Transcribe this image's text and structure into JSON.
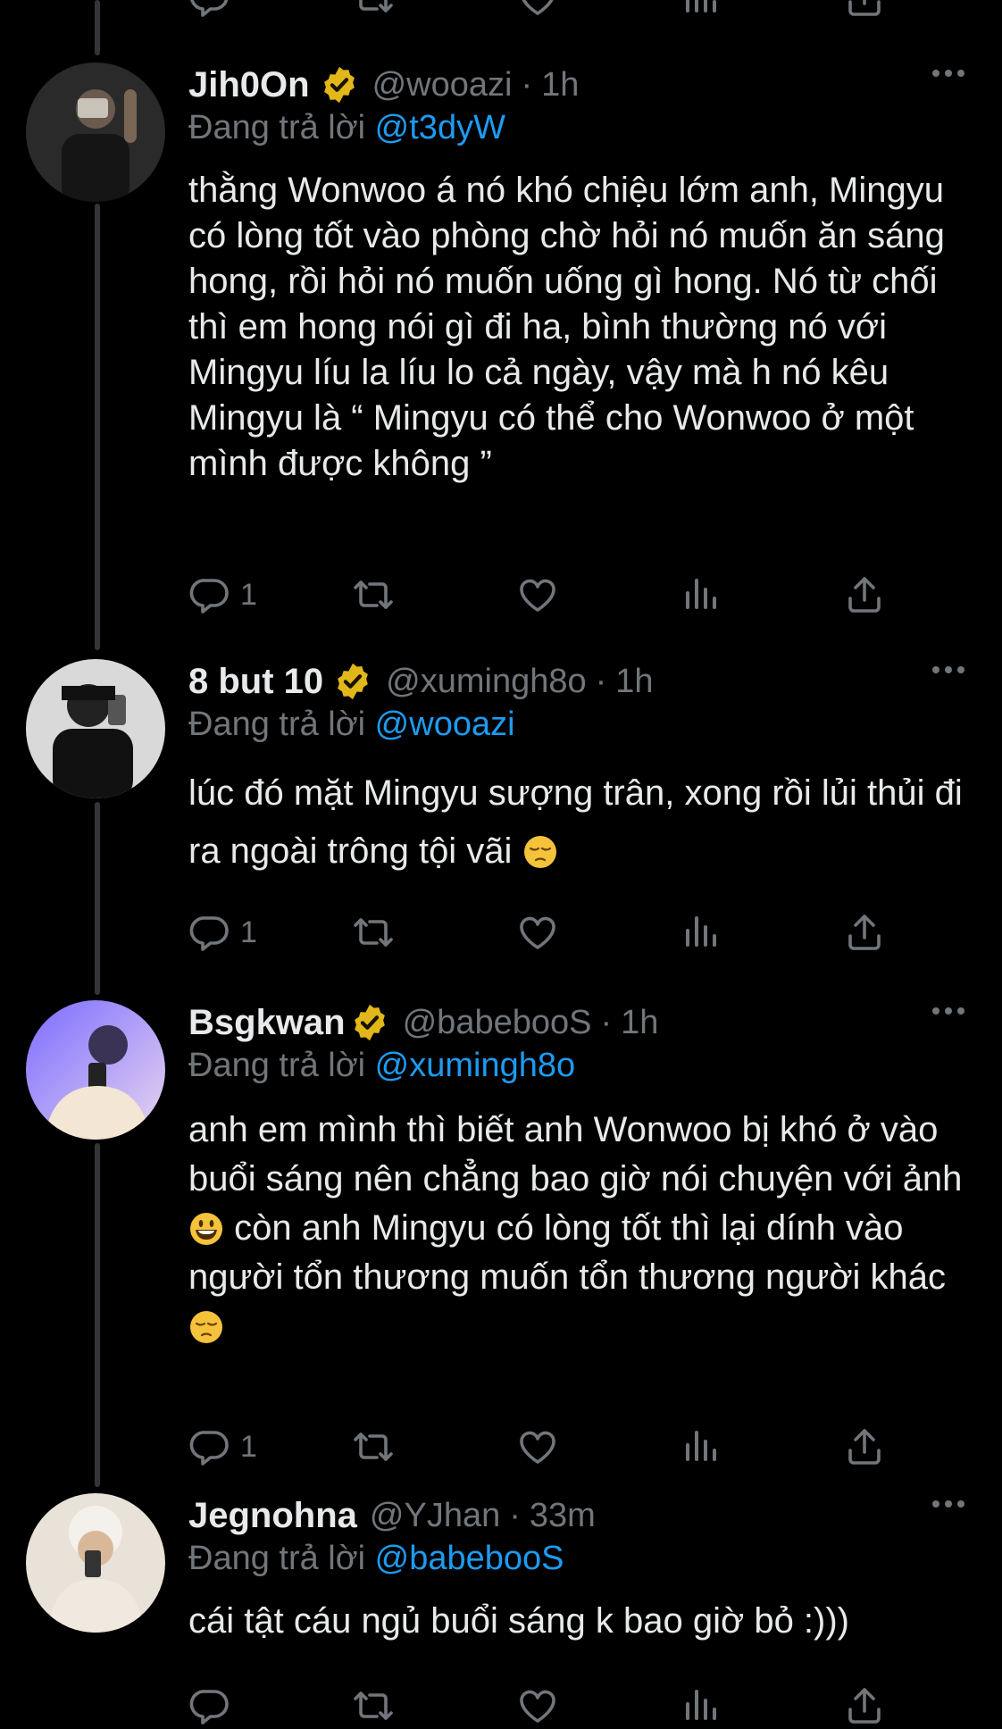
{
  "tweets": [
    {
      "name": "Jih0On",
      "handle": "@wooazi",
      "time": "1h",
      "replying_label": "Đang trả lời",
      "replying_to": "@t3dyW",
      "text": "thằng Wonwoo á nó khó chiệu lớm anh, Mingyu có lòng tốt vào phòng chờ hỏi nó muốn ăn sáng hong, rồi hỏi nó muốn uống gì hong. Nó từ chối thì em hong nói gì đi ha, bình thường nó với Mingyu líu la líu lo cả ngày, vậy mà h nó kêu Mingyu là “ Mingyu có thể cho Wonwoo ở một mình được không ”",
      "reply_count": "1"
    },
    {
      "name": "8 but 10",
      "handle": "@xumingh8o",
      "time": "1h",
      "replying_label": "Đang trả lời",
      "replying_to": "@wooazi",
      "text": "lúc đó mặt Mingyu sượng trân, xong rồi lủi thủi đi ra ngoài trông tội vãi",
      "emoji_end": "pensive-face",
      "reply_count": "1"
    },
    {
      "name": "Bsgkwan",
      "handle": "@babebooS",
      "time": "1h",
      "replying_label": "Đang trả lời",
      "replying_to": "@xumingh8o",
      "text_a": "anh em mình thì biết anh Wonwoo bị khó ở vào buổi sáng nên chẳng bao giờ nói chuyện với ảnh",
      "text_b": " còn anh Mingyu có lòng tốt thì lại dính vào người tổn thương muốn tổn thương người khác",
      "emoji_mid": "smiley-face",
      "emoji_end": "pensive-face",
      "reply_count": "1"
    },
    {
      "name": "Jegnohna",
      "handle": "@YJhan",
      "time": "33m",
      "replying_label": "Đang trả lời",
      "replying_to": "@babebooS",
      "text": "cái tật cáu ngủ buổi sáng k bao giờ bỏ :)))"
    }
  ],
  "colors": {
    "background": "#000000",
    "text": "#e7e9ea",
    "secondary": "#71767b",
    "link": "#1d9bf0",
    "verified_badge": "#e2b719"
  },
  "icons": [
    "reply-icon",
    "retweet-icon",
    "like-icon",
    "views-icon",
    "share-icon",
    "verified-badge-icon",
    "more-icon"
  ]
}
